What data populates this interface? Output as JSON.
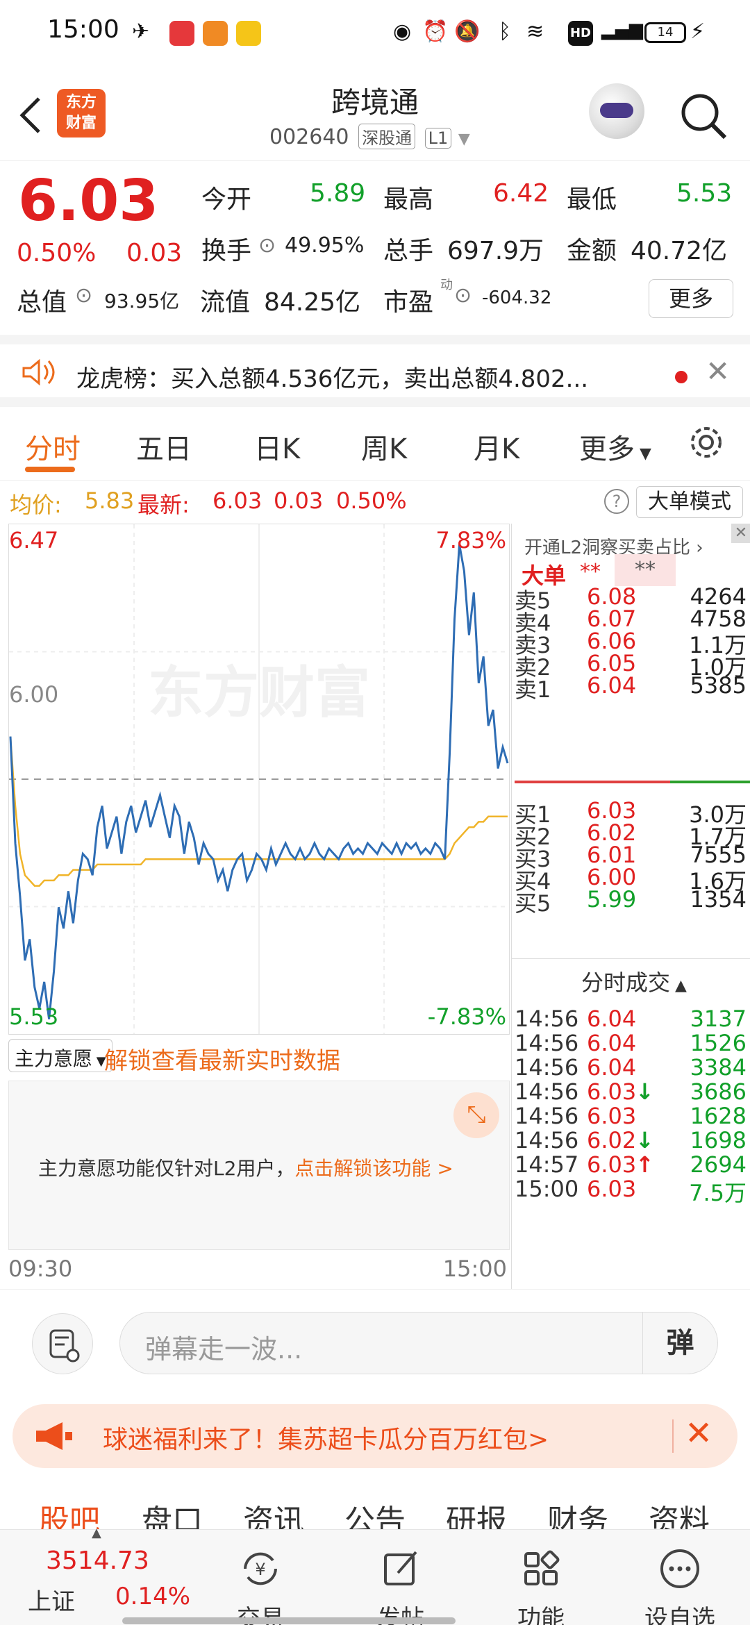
{
  "status": {
    "time": "15:00",
    "battery": "14",
    "icons": [
      "plane-icon",
      "xiaohongshu-icon",
      "app-icon",
      "mail-icon",
      "drop-icon",
      "alarm-icon",
      "mute-icon",
      "bluetooth-icon",
      "wifi-icon",
      "hd-icon",
      "4g-signal-icon",
      "battery-icon",
      "charging-icon"
    ]
  },
  "header": {
    "logo": "东方财富",
    "title": "跨境通",
    "code": "002640",
    "market_tag": "深股通",
    "level_tag": "L1"
  },
  "quote": {
    "price": "6.03",
    "change_pct": "0.50%",
    "change": "0.03",
    "open_label": "今开",
    "open": "5.89",
    "high_label": "最高",
    "high": "6.42",
    "low_label": "最低",
    "low": "5.53",
    "turnover_label": "换手",
    "turnover": "49.95%",
    "volume_label": "总手",
    "volume": "697.9万",
    "amount_label": "金额",
    "amount": "40.72亿",
    "mktcap_label": "总值",
    "mktcap": "93.95亿",
    "float_label": "流值",
    "float": "84.25亿",
    "pe_label": "市盈",
    "pe_sup": "动",
    "pe": "-604.32",
    "more": "更多"
  },
  "notice": {
    "text": "龙虎榜：买入总额4.536亿元，卖出总额4.802..."
  },
  "tabs": [
    "分时",
    "五日",
    "日K",
    "周K",
    "月K",
    "更多"
  ],
  "info": {
    "avg_label": "均价:",
    "avg": "5.83",
    "latest_label": "最新:",
    "latest": "6.03",
    "chg": "0.03",
    "pct": "0.50%",
    "bigorder_mode": "大单模式",
    "help": "?"
  },
  "chart": {
    "top_price": "6.47",
    "top_pct": "7.83%",
    "mid_price": "6.00",
    "bottom_price": "5.53",
    "bottom_pct": "-7.83%",
    "watermark": "东方财富",
    "time_start": "09:30",
    "time_end": "15:00"
  },
  "chart_data": {
    "type": "line",
    "ylim": [
      5.53,
      6.47
    ],
    "reference": 6.0,
    "series": [
      {
        "values": [
          6.08,
          5.88,
          5.78,
          5.66,
          5.7,
          5.61,
          5.57,
          5.62,
          5.55,
          5.64,
          5.76,
          5.72,
          5.79,
          5.73,
          5.81,
          5.86,
          5.85,
          5.82,
          5.91,
          5.95,
          5.87,
          5.9,
          5.93,
          5.86,
          5.92,
          5.95,
          5.9,
          5.93,
          5.96,
          5.91,
          5.94,
          5.97,
          5.93,
          5.89,
          5.95,
          5.93,
          5.86,
          5.92,
          5.89,
          5.84,
          5.88,
          5.86,
          5.85,
          5.81,
          5.83,
          5.79,
          5.83,
          5.85,
          5.86,
          5.81,
          5.83,
          5.86,
          5.85,
          5.83,
          5.87,
          5.84,
          5.86,
          5.88,
          5.86,
          5.85,
          5.87,
          5.85,
          5.86,
          5.88,
          5.86,
          5.85,
          5.87,
          5.86,
          5.85,
          5.87,
          5.88,
          5.86,
          5.87,
          5.86,
          5.88,
          5.87,
          5.86,
          5.88,
          5.87,
          5.86,
          5.88,
          5.86,
          5.88,
          5.87,
          5.88,
          5.86,
          5.87,
          5.86,
          5.88,
          5.87,
          5.85,
          6.05,
          6.3,
          6.44,
          6.39,
          6.27,
          6.35,
          6.18,
          6.23,
          6.1,
          6.13,
          6.02,
          6.06,
          6.03
        ]
      },
      {
        "values": [
          6.08,
          5.95,
          5.86,
          5.82,
          5.81,
          5.8,
          5.8,
          5.81,
          5.81,
          5.81,
          5.82,
          5.82,
          5.82,
          5.83,
          5.83,
          5.83,
          5.83,
          5.83,
          5.84,
          5.84,
          5.84,
          5.84,
          5.84,
          5.84,
          5.84,
          5.84,
          5.84,
          5.84,
          5.85,
          5.85,
          5.85,
          5.85,
          5.85,
          5.85,
          5.85,
          5.85,
          5.85,
          5.85,
          5.85,
          5.85,
          5.85,
          5.85,
          5.85,
          5.85,
          5.85,
          5.85,
          5.85,
          5.85,
          5.85,
          5.85,
          5.85,
          5.85,
          5.85,
          5.85,
          5.85,
          5.85,
          5.85,
          5.85,
          5.85,
          5.85,
          5.85,
          5.85,
          5.85,
          5.85,
          5.85,
          5.85,
          5.85,
          5.85,
          5.85,
          5.85,
          5.85,
          5.85,
          5.85,
          5.85,
          5.85,
          5.85,
          5.85,
          5.85,
          5.85,
          5.85,
          5.85,
          5.85,
          5.85,
          5.85,
          5.85,
          5.85,
          5.85,
          5.85,
          5.85,
          5.85,
          5.85,
          5.86,
          5.88,
          5.89,
          5.9,
          5.91,
          5.91,
          5.92,
          5.92,
          5.93,
          5.93,
          5.93,
          5.93,
          5.93
        ]
      }
    ]
  },
  "book": {
    "l2_promo": "开通L2洞察买卖占比",
    "bigorder_label": "大单",
    "bigorder_a": "**",
    "bigorder_b": "**",
    "asks": [
      {
        "label": "卖5",
        "price": "6.08",
        "vol": "4264"
      },
      {
        "label": "卖4",
        "price": "6.07",
        "vol": "4758"
      },
      {
        "label": "卖3",
        "price": "6.06",
        "vol": "1.1万"
      },
      {
        "label": "卖2",
        "price": "6.05",
        "vol": "1.0万"
      },
      {
        "label": "卖1",
        "price": "6.04",
        "vol": "5385"
      }
    ],
    "bids": [
      {
        "label": "买1",
        "price": "6.03",
        "vol": "3.0万"
      },
      {
        "label": "买2",
        "price": "6.02",
        "vol": "1.7万"
      },
      {
        "label": "买3",
        "price": "6.01",
        "vol": "7555"
      },
      {
        "label": "买4",
        "price": "6.00",
        "vol": "1.6万"
      },
      {
        "label": "买5",
        "price": "5.99",
        "vol": "1354"
      }
    ],
    "trades_title": "分时成交",
    "trades": [
      {
        "time": "14:56",
        "price": "6.04",
        "arrow": "",
        "vol": "3137"
      },
      {
        "time": "14:56",
        "price": "6.04",
        "arrow": "",
        "vol": "1526"
      },
      {
        "time": "14:56",
        "price": "6.04",
        "arrow": "",
        "vol": "3384"
      },
      {
        "time": "14:56",
        "price": "6.03",
        "arrow": "↓",
        "vol": "3686"
      },
      {
        "time": "14:56",
        "price": "6.03",
        "arrow": "",
        "vol": "1628"
      },
      {
        "time": "14:56",
        "price": "6.02",
        "arrow": "↓",
        "vol": "1698"
      },
      {
        "time": "14:57",
        "price": "6.03",
        "arrow": "↑",
        "vol": "2694"
      },
      {
        "time": "15:00",
        "price": "6.03",
        "arrow": "",
        "vol": "7.5万"
      }
    ]
  },
  "wish": {
    "select": "主力意愿",
    "unlock_title": "解锁查看最新实时数据",
    "notice": "主力意愿功能仅针对L2用户，",
    "notice_link": "点击解锁该功能 >"
  },
  "comment": {
    "placeholder": "弹幕走一波...",
    "dan": "弹"
  },
  "promo": {
    "text": "球迷福利来了！集苏超卡瓜分百万红包>"
  },
  "bottom_tabs": [
    "股吧",
    "盘口",
    "资讯",
    "公告",
    "研报",
    "财务",
    "资料"
  ],
  "nav": {
    "index_value": "3514.73",
    "index_name": "上证",
    "index_pct": "0.14%",
    "items": [
      "交易",
      "发帖",
      "功能",
      "设自选"
    ]
  },
  "colors": {
    "up": "#e02020",
    "down": "#12a02a",
    "accent": "#ec6b1b",
    "line": "#2e6db4",
    "avg": "#f0b429"
  }
}
